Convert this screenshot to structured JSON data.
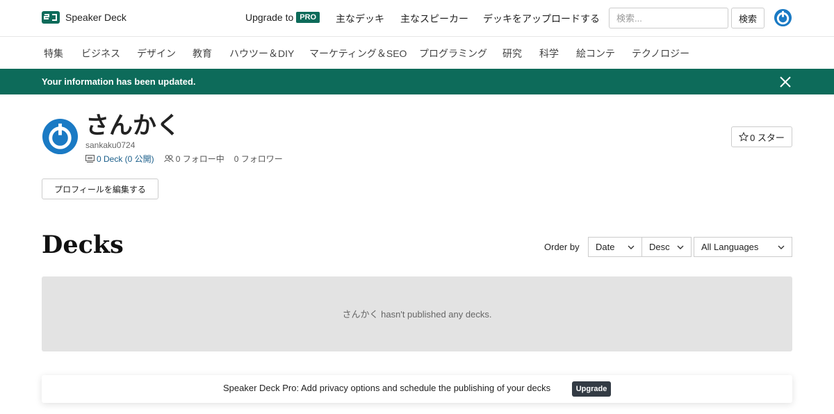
{
  "header": {
    "logo_text": "Speaker Deck",
    "upgrade_label": "Upgrade to",
    "pro_badge": "PRO",
    "nav": [
      "主なデッキ",
      "主なスピーカー",
      "デッキをアップロードする"
    ],
    "search_placeholder": "検索...",
    "search_button": "検索",
    "brand_color": "#0d6b5a"
  },
  "categories": [
    "特集",
    "ビジネス",
    "デザイン",
    "教育",
    "ハウツー＆DIY",
    "マーケティング＆SEO",
    "プログラミング",
    "研究",
    "科学",
    "絵コンテ",
    "テクノロジー"
  ],
  "flash": {
    "message": "Your information has been updated.",
    "close_icon": "close-icon"
  },
  "profile": {
    "name": "さんかく",
    "username": "sankaku0724",
    "decks_count": "0 Deck (0 公開)",
    "following": "0 フォロー中",
    "followers": "0 フォロワー",
    "star_button": "0 スター",
    "edit_button": "プロフィールを編集する"
  },
  "decks": {
    "title": "Decks",
    "order_label": "Order by",
    "order_field": "Date",
    "order_direction": "Desc",
    "language": "All Languages",
    "empty_message": "さんかく hasn't published any decks."
  },
  "promo": {
    "text": "Speaker Deck Pro: Add privacy options and schedule the publishing of your decks",
    "button": "Upgrade"
  }
}
